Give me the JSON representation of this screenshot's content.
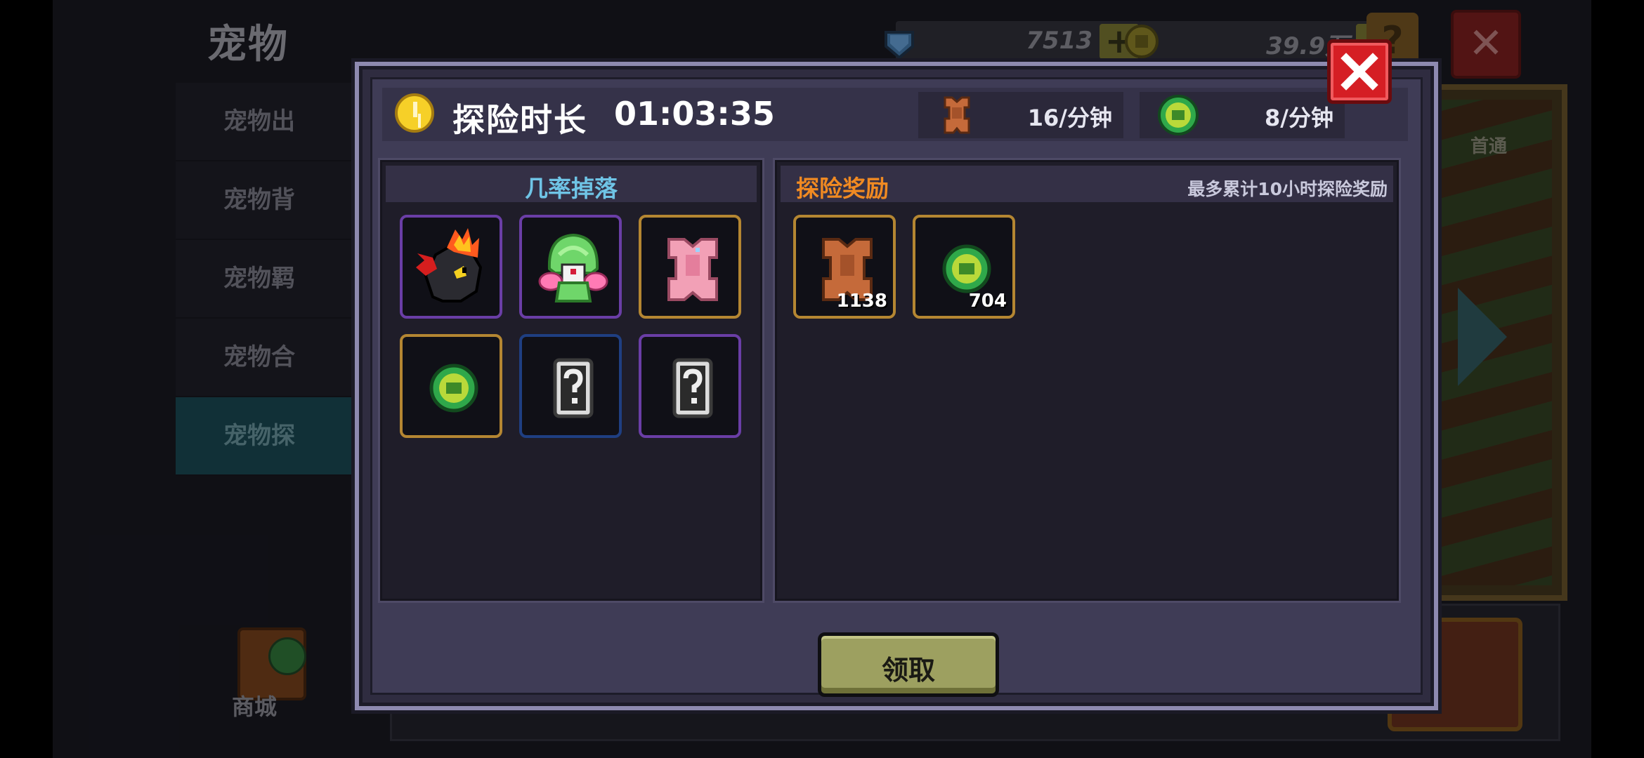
{
  "background": {
    "title": "宠物",
    "gems": "7513",
    "coins": "39.9万",
    "plus_symbol": "+",
    "help_symbol": "?",
    "close_symbol": "✕",
    "menu": [
      {
        "label": "宠物出"
      },
      {
        "label": "宠物背"
      },
      {
        "label": "宠物羁"
      },
      {
        "label": "宠物合"
      },
      {
        "label": "宠物探",
        "active": true
      }
    ],
    "shop_label": "商城",
    "first_clear": "首通"
  },
  "modal": {
    "header": {
      "title": "探险时长",
      "time": "01:03:35",
      "rates": [
        {
          "icon": "leather-material-icon",
          "text": "16/分钟"
        },
        {
          "icon": "green-coin-icon",
          "text": "8/分钟"
        }
      ]
    },
    "drop_panel": {
      "title": "几率掉落",
      "title_color": "#6fc4e6",
      "items": [
        {
          "name": "fire-dragon-pet-icon",
          "rarity": "purple"
        },
        {
          "name": "green-plant-pet-icon",
          "rarity": "purple"
        },
        {
          "name": "pink-leather-icon",
          "rarity": "orange"
        },
        {
          "name": "green-coin-icon",
          "rarity": "orange"
        },
        {
          "name": "mystery-item-icon",
          "rarity": "blue"
        },
        {
          "name": "mystery-item-icon",
          "rarity": "purple"
        }
      ]
    },
    "reward_panel": {
      "title": "探险奖励",
      "title_color": "#f08a22",
      "note": "最多累计10小时探险奖励",
      "items": [
        {
          "name": "leather-material-icon",
          "count": "1138",
          "rarity": "orange"
        },
        {
          "name": "green-coin-icon",
          "count": "704",
          "rarity": "orange"
        }
      ]
    },
    "claim_button": "领取"
  }
}
